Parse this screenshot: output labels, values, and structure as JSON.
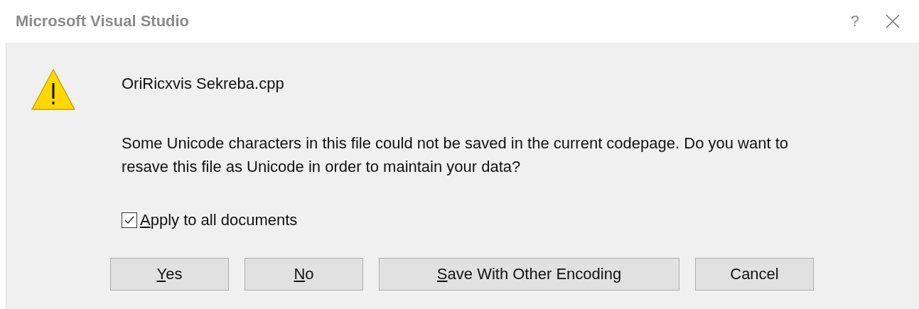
{
  "window": {
    "title": "Microsoft Visual Studio",
    "help_button": "?"
  },
  "file_name": "OriRicxvis Sekreba.cpp",
  "message": "Some Unicode characters in this file could not be saved in the current codepage. Do you want to resave this file as Unicode in order to maintain your data?",
  "checkbox": {
    "label": "Apply to all documents",
    "checked": true,
    "access_key": true
  },
  "buttons": [
    {
      "label": "Yes",
      "access_key": true
    },
    {
      "label": "No",
      "access_key": true
    },
    {
      "label": "Save With Other Encoding",
      "access_key": true
    },
    {
      "label": "Cancel",
      "access_key": false
    }
  ]
}
